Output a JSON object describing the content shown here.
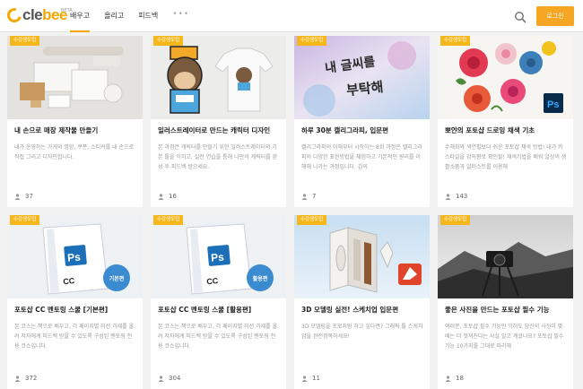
{
  "header": {
    "logo_text_1": "cle",
    "logo_text_2": "bee",
    "logo_beta": "BETA",
    "nav": [
      "배우고",
      "올리고",
      "피드백"
    ],
    "more": "•••",
    "login_label": "로그인"
  },
  "colors": {
    "accent": "#f5a623",
    "badge": "#f5b719"
  },
  "cards": [
    {
      "badge": "수강생모집",
      "title": "내 손으로 매장 제작물 만들기",
      "desc": "내가 운영하는 가게의 명함, 쿠폰, 스티커를 내 손으로 직접 그리고 디자인합니다.",
      "count": "37"
    },
    {
      "badge": "수강생모집",
      "title": "일러스트레이터로 만드는 캐릭터 디자인",
      "desc": "본 과정은 캐릭터를 만들기 위한 일러스트레이터의 기본 툴을 익히고, 실전 연습을 통해 나만의 캐릭터를 완성 후 피드백 받으세요.",
      "count": "16"
    },
    {
      "badge": "수강생모집",
      "title": "하루 30분 캘리그라피, 입문편",
      "desc": "캘리그라피의 이해부터 시작하는 8회 과정은 캘리그라피의 다양한 표현방법을 체험하고 기본적인 원리를 이해해 나가는 과정입니다. 감의",
      "count": "7",
      "thumb_text_1": "내 글씨를",
      "thumb_text_2": "부탁해"
    },
    {
      "badge": "수강생모집",
      "title": "뽀얀의 포토샵 드로잉 채색 기초",
      "desc": "수채화와 색연필보다 쉬운 포토샵 채색 방법! 내가 키 스타일을 강의평로 확인할! 채색기법을 배워 일상의 생활소품과 일러스트를 이용해",
      "count": "143"
    },
    {
      "badge": "수강생모집",
      "title": "포토샵 CC 멘토링 스쿨 [기본편]",
      "desc": "본 코스는 책으로 배우고, 각 페이지별 미션 과제를 올려 저자에게 피드백 받을 수 있도록 구성된 멘토링 전용 코스입니다.",
      "count": "372",
      "book_label": "기본편"
    },
    {
      "badge": "수강생모집",
      "title": "포토샵 CC 멘토링 스쿨 [활용편]",
      "desc": "본 코스는 책으로 배우고, 각 페이지별 미션 과제를 올려 저자에게 피드백 받을 수 있도록 구성된 멘토링 전용 코스입니다.",
      "count": "304",
      "book_label": "활용편"
    },
    {
      "badge": "수강생모집",
      "title": "3D 모델링 실전! 스케치업 입문편",
      "desc": "3D 모델링을 포로처럼 하고 싶다면? 그래픽 툴 스케치업을 완전정복하세요!",
      "count": "11"
    },
    {
      "badge": "수강생모집",
      "title": "좋은 사진을 만드는 포토샵 필수 기능",
      "desc": "여러분, 포토샵 필수 기능만 익혀도 당신의 사진이 몇 배는 더 멋져진다는 사실 알고 계셨나요? 포토샵 필수 기능 10가지를 그대로 따라해",
      "count": "18"
    }
  ]
}
